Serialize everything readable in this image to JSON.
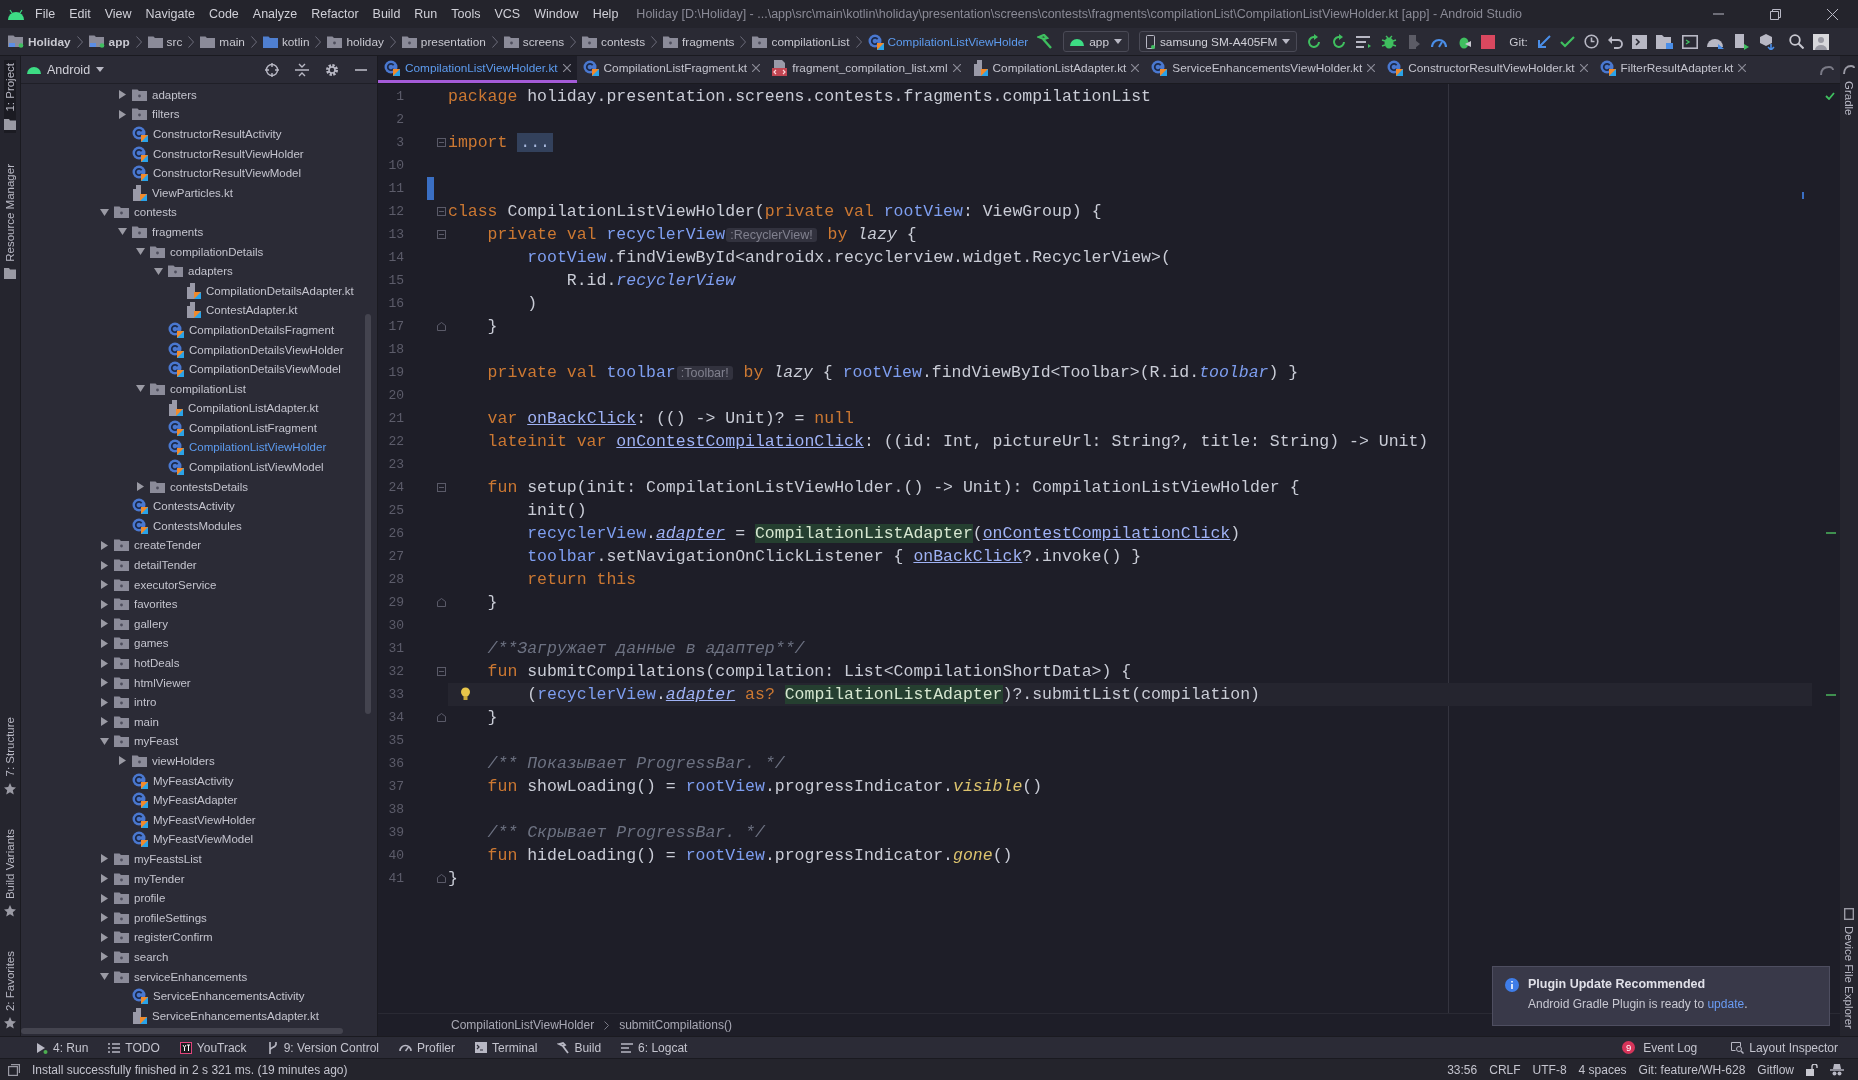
{
  "menu_bar": {
    "items": [
      "File",
      "Edit",
      "View",
      "Navigate",
      "Code",
      "Analyze",
      "Refactor",
      "Build",
      "Run",
      "Tools",
      "VCS",
      "Window",
      "Help"
    ],
    "title": "Holiday [D:\\Holiday] - ...\\app\\src\\main\\kotlin\\holiday\\presentation\\screens\\contests\\fragments\\compilationList\\CompilationListViewHolder.kt [app] - Android Studio"
  },
  "navigation_bar": {
    "breadcrumbs": [
      {
        "label": "Holiday",
        "kind": "module"
      },
      {
        "label": "app",
        "kind": "module"
      },
      {
        "label": "src",
        "kind": "folder"
      },
      {
        "label": "main",
        "kind": "folder"
      },
      {
        "label": "kotlin",
        "kind": "source_folder"
      },
      {
        "label": "holiday",
        "kind": "package"
      },
      {
        "label": "presentation",
        "kind": "package"
      },
      {
        "label": "screens",
        "kind": "package"
      },
      {
        "label": "contests",
        "kind": "package"
      },
      {
        "label": "fragments",
        "kind": "package"
      },
      {
        "label": "compilationList",
        "kind": "package"
      },
      {
        "label": "CompilationListViewHolder",
        "kind": "class"
      }
    ],
    "run_configuration": "app",
    "device": "samsung SM-A405FM",
    "git_label": "Git:"
  },
  "left_toolbar": {
    "top": [
      "1: Project",
      "Resource Manager"
    ],
    "bottom": [
      "7: Structure",
      "Build Variants",
      "2: Favorites"
    ]
  },
  "right_toolbar": {
    "top": [
      "Gradle"
    ],
    "bottom": [
      "Device File Explorer"
    ]
  },
  "project": {
    "view": "Android",
    "leading_items": [
      {
        "label": "adapters",
        "kind": "folder",
        "expanded": false,
        "selected": false
      },
      {
        "label": "filters",
        "kind": "folder",
        "expanded": false,
        "selected": false
      },
      {
        "label": "ConstructorResultActivity",
        "kind": "class",
        "selected": false
      },
      {
        "label": "ConstructorResultViewHolder",
        "kind": "class",
        "selected": false
      },
      {
        "label": "ConstructorResultViewModel",
        "kind": "class",
        "selected": false
      },
      {
        "label": "ViewParticles.kt",
        "kind": "file",
        "selected": false
      }
    ],
    "items": [
      {
        "label": "contests",
        "kind": "folder",
        "expanded": true,
        "selected": false,
        "children": [
          {
            "label": "fragments",
            "kind": "folder",
            "expanded": true,
            "selected": false,
            "children": [
              {
                "label": "compilationDetails",
                "kind": "folder",
                "expanded": true,
                "selected": false,
                "children": [
                  {
                    "label": "adapters",
                    "kind": "folder",
                    "expanded": true,
                    "selected": false,
                    "children": [
                      {
                        "label": "CompilationDetailsAdapter.kt",
                        "kind": "file",
                        "selected": false
                      },
                      {
                        "label": "ContestAdapter.kt",
                        "kind": "file",
                        "selected": false
                      }
                    ]
                  },
                  {
                    "label": "CompilationDetailsFragment",
                    "kind": "class",
                    "selected": false
                  },
                  {
                    "label": "CompilationDetailsViewHolder",
                    "kind": "class",
                    "selected": false
                  },
                  {
                    "label": "CompilationDetailsViewModel",
                    "kind": "class",
                    "selected": false
                  }
                ]
              },
              {
                "label": "compilationList",
                "kind": "folder",
                "expanded": true,
                "selected": false,
                "children": [
                  {
                    "label": "CompilationListAdapter.kt",
                    "kind": "file",
                    "selected": false
                  },
                  {
                    "label": "CompilationListFragment",
                    "kind": "class",
                    "selected": false
                  },
                  {
                    "label": "CompilationListViewHolder",
                    "kind": "class",
                    "selected": true
                  },
                  {
                    "label": "CompilationListViewModel",
                    "kind": "class",
                    "selected": false
                  }
                ]
              },
              {
                "label": "contestsDetails",
                "kind": "folder",
                "expanded": false,
                "selected": false
              }
            ]
          },
          {
            "label": "ContestsActivity",
            "kind": "class",
            "selected": false
          },
          {
            "label": "ContestsModules",
            "kind": "class",
            "selected": false
          }
        ]
      },
      {
        "label": "createTender",
        "kind": "folder",
        "expanded": false,
        "selected": false
      },
      {
        "label": "detailTender",
        "kind": "folder",
        "expanded": false,
        "selected": false
      },
      {
        "label": "executorService",
        "kind": "folder",
        "expanded": false,
        "selected": false
      },
      {
        "label": "favorites",
        "kind": "folder",
        "expanded": false,
        "selected": false
      },
      {
        "label": "gallery",
        "kind": "folder",
        "expanded": false,
        "selected": false
      },
      {
        "label": "games",
        "kind": "folder",
        "expanded": false,
        "selected": false
      },
      {
        "label": "hotDeals",
        "kind": "folder",
        "expanded": false,
        "selected": false
      },
      {
        "label": "htmlViewer",
        "kind": "folder",
        "expanded": false,
        "selected": false
      },
      {
        "label": "intro",
        "kind": "folder",
        "expanded": false,
        "selected": false
      },
      {
        "label": "main",
        "kind": "folder",
        "expanded": false,
        "selected": false
      },
      {
        "label": "myFeast",
        "kind": "folder",
        "expanded": true,
        "selected": false,
        "children": [
          {
            "label": "viewHolders",
            "kind": "folder",
            "expanded": false,
            "selected": false
          },
          {
            "label": "MyFeastActivity",
            "kind": "class",
            "selected": false
          },
          {
            "label": "MyFeastAdapter",
            "kind": "class",
            "selected": false
          },
          {
            "label": "MyFeastViewHolder",
            "kind": "class",
            "selected": false
          },
          {
            "label": "MyFeastViewModel",
            "kind": "class",
            "selected": false
          }
        ]
      },
      {
        "label": "myFeastsList",
        "kind": "folder",
        "expanded": false,
        "selected": false
      },
      {
        "label": "myTender",
        "kind": "folder",
        "expanded": false,
        "selected": false
      },
      {
        "label": "profile",
        "kind": "folder",
        "expanded": false,
        "selected": false
      },
      {
        "label": "profileSettings",
        "kind": "folder",
        "expanded": false,
        "selected": false
      },
      {
        "label": "registerConfirm",
        "kind": "folder",
        "expanded": false,
        "selected": false
      },
      {
        "label": "search",
        "kind": "folder",
        "expanded": false,
        "selected": false
      },
      {
        "label": "serviceEnhancements",
        "kind": "folder",
        "expanded": true,
        "selected": false,
        "children": [
          {
            "label": "ServiceEnhancementsActivity",
            "kind": "class",
            "selected": false
          },
          {
            "label": "ServiceEnhancementsAdapter.kt",
            "kind": "file",
            "selected": false
          }
        ]
      }
    ]
  },
  "editor_tabs": [
    {
      "label": "CompilationListViewHolder.kt",
      "kind": "class",
      "selected": true
    },
    {
      "label": "CompilationListFragment.kt",
      "kind": "class",
      "selected": false
    },
    {
      "label": "fragment_compilation_list.xml",
      "kind": "layout",
      "selected": false
    },
    {
      "label": "CompilationListAdapter.kt",
      "kind": "file",
      "selected": false
    },
    {
      "label": "ServiceEnhancementsViewHolder.kt",
      "kind": "class",
      "selected": false
    },
    {
      "label": "ConstructorResultViewHolder.kt",
      "kind": "class",
      "selected": false
    },
    {
      "label": "FilterResultAdapter.kt",
      "kind": "class",
      "selected": false
    }
  ],
  "code": {
    "lines": [
      {
        "number": "1",
        "kind": "plain",
        "current": false,
        "changed": false,
        "tokens": [
          {
            "kind": "keyword",
            "text": "package"
          },
          {
            "kind": "plain",
            "text": " holiday.presentation.screens.contests.fragments.compilationList"
          }
        ]
      },
      {
        "number": "2",
        "kind": "plain",
        "current": false,
        "changed": false
      },
      {
        "number": "3",
        "kind": "fold_start",
        "current": false,
        "changed": false,
        "tokens": [
          {
            "kind": "keyword",
            "text": "import"
          },
          {
            "kind": "folded",
            "text": "..."
          }
        ]
      },
      {
        "number": "10",
        "kind": "plain",
        "current": false,
        "changed": false
      },
      {
        "number": "11",
        "kind": "plain",
        "current": false,
        "changed": true
      },
      {
        "number": "12",
        "kind": "fold_start",
        "current": false,
        "changed": false,
        "tokens": [
          {
            "kind": "keyword",
            "text": "class"
          },
          {
            "kind": "plain",
            "text": " CompilationListViewHolder("
          },
          {
            "kind": "keyword",
            "text": "private val"
          },
          {
            "kind": "property",
            "text": " rootView"
          },
          {
            "kind": "plain",
            "text": ": ViewGroup) {"
          }
        ]
      },
      {
        "number": "13",
        "kind": "fold_start",
        "current": false,
        "changed": false,
        "tokens": [
          {
            "kind": "keyword",
            "text": "    private val"
          },
          {
            "kind": "property",
            "text": " recyclerView"
          },
          {
            "kind": "type_hint",
            "text": ":RecyclerView!"
          },
          {
            "kind": "keyword",
            "text": " by"
          },
          {
            "kind": "italic",
            "text": " lazy"
          },
          {
            "kind": "plain",
            "text": " {"
          }
        ]
      },
      {
        "number": "14",
        "kind": "plain",
        "current": false,
        "changed": false,
        "tokens": [
          {
            "kind": "property",
            "text": "        rootView"
          },
          {
            "kind": "plain",
            "text": ".findViewById<androidx.recyclerview.widget.RecyclerView>("
          }
        ]
      },
      {
        "number": "15",
        "kind": "plain",
        "current": false,
        "changed": false,
        "tokens": [
          {
            "kind": "plain",
            "text": "            R.id."
          },
          {
            "kind": "property_italic",
            "text": "recyclerView"
          }
        ]
      },
      {
        "number": "16",
        "kind": "plain",
        "current": false,
        "changed": false,
        "tokens": [
          {
            "kind": "plain",
            "text": "        )"
          }
        ]
      },
      {
        "number": "17",
        "kind": "fold_end",
        "current": false,
        "changed": false,
        "tokens": [
          {
            "kind": "plain",
            "text": "    }"
          }
        ]
      },
      {
        "number": "18",
        "kind": "plain",
        "current": false,
        "changed": false
      },
      {
        "number": "19",
        "kind": "plain",
        "current": false,
        "changed": false,
        "tokens": [
          {
            "kind": "keyword",
            "text": "    private val"
          },
          {
            "kind": "property",
            "text": " toolbar"
          },
          {
            "kind": "type_hint",
            "text": ":Toolbar!"
          },
          {
            "kind": "keyword",
            "text": " by"
          },
          {
            "kind": "italic",
            "text": " lazy"
          },
          {
            "kind": "plain",
            "text": " {"
          },
          {
            "kind": "property",
            "text": " rootView"
          },
          {
            "kind": "plain",
            "text": ".findViewById<Toolbar>(R.id."
          },
          {
            "kind": "property_italic",
            "text": "toolbar"
          },
          {
            "kind": "plain",
            "text": ") }"
          }
        ]
      },
      {
        "number": "20",
        "kind": "plain",
        "current": false,
        "changed": false
      },
      {
        "number": "21",
        "kind": "plain",
        "current": false,
        "changed": false,
        "tokens": [
          {
            "kind": "keyword",
            "text": "    var "
          },
          {
            "kind": "reference",
            "text": "onBackClick"
          },
          {
            "kind": "plain",
            "text": ": (() -> Unit)? ="
          },
          {
            "kind": "keyword",
            "text": " null"
          }
        ]
      },
      {
        "number": "22",
        "kind": "plain",
        "current": false,
        "changed": false,
        "tokens": [
          {
            "kind": "keyword",
            "text": "    lateinit var "
          },
          {
            "kind": "reference",
            "text": "onContestCompilationClick"
          },
          {
            "kind": "plain",
            "text": ": ((id: Int, pictureUrl: String?, title: String) -> Unit)"
          }
        ]
      },
      {
        "number": "23",
        "kind": "plain",
        "current": false,
        "changed": false
      },
      {
        "number": "24",
        "kind": "fold_start",
        "current": false,
        "changed": false,
        "tokens": [
          {
            "kind": "keyword",
            "text": "    fun"
          },
          {
            "kind": "plain",
            "text": " setup(init: CompilationListViewHolder.() -> Unit): CompilationListViewHolder {"
          }
        ]
      },
      {
        "number": "25",
        "kind": "plain",
        "current": false,
        "changed": false,
        "tokens": [
          {
            "kind": "plain",
            "text": "        init()"
          }
        ]
      },
      {
        "number": "26",
        "kind": "plain",
        "current": false,
        "changed": false,
        "tokens": [
          {
            "kind": "property",
            "text": "        recyclerView"
          },
          {
            "kind": "plain",
            "text": "."
          },
          {
            "kind": "reference_italic",
            "text": "adapter"
          },
          {
            "kind": "plain",
            "text": " ="
          },
          {
            "kind": "highlighted",
            "text": "CompilationListAdapter"
          },
          {
            "kind": "plain",
            "text": "("
          },
          {
            "kind": "reference",
            "text": "onContestCompilationClick"
          },
          {
            "kind": "plain",
            "text": ")"
          }
        ]
      },
      {
        "number": "27",
        "kind": "plain",
        "current": false,
        "changed": false,
        "tokens": [
          {
            "kind": "property",
            "text": "        toolbar"
          },
          {
            "kind": "plain",
            "text": ".setNavigationOnClickListener { "
          },
          {
            "kind": "reference",
            "text": "onBackClick"
          },
          {
            "kind": "plain",
            "text": "?.invoke() }"
          }
        ]
      },
      {
        "number": "28",
        "kind": "plain",
        "current": false,
        "changed": false,
        "tokens": [
          {
            "kind": "keyword",
            "text": "        return this"
          }
        ]
      },
      {
        "number": "29",
        "kind": "fold_end",
        "current": false,
        "changed": false,
        "tokens": [
          {
            "kind": "plain",
            "text": "    }"
          }
        ]
      },
      {
        "number": "30",
        "kind": "plain",
        "current": false,
        "changed": false
      },
      {
        "number": "31",
        "kind": "plain",
        "current": false,
        "changed": false,
        "tokens": [
          {
            "kind": "comment",
            "text": "    /**Загружает данные в адаптер**/"
          }
        ]
      },
      {
        "number": "32",
        "kind": "fold_start",
        "current": false,
        "changed": false,
        "tokens": [
          {
            "kind": "keyword",
            "text": "    fun"
          },
          {
            "kind": "plain",
            "text": " submitCompilations(compilation: List<CompilationShortData>) {"
          }
        ]
      },
      {
        "number": "33",
        "kind": "plain",
        "current": true,
        "changed": false,
        "tokens": [
          {
            "kind": "plain",
            "text": "        ("
          },
          {
            "kind": "property",
            "text": "recyclerView"
          },
          {
            "kind": "plain",
            "text": "."
          },
          {
            "kind": "reference_italic",
            "text": "adapter"
          },
          {
            "kind": "keyword",
            "text": " as?"
          },
          {
            "kind": "highlighted",
            "text": "CompilationListAdapter"
          },
          {
            "kind": "plain",
            "text": ")?.submitList(compilation)"
          }
        ]
      },
      {
        "number": "34",
        "kind": "fold_end",
        "current": false,
        "changed": false,
        "tokens": [
          {
            "kind": "plain",
            "text": "    }"
          }
        ]
      },
      {
        "number": "35",
        "kind": "plain",
        "current": false,
        "changed": false
      },
      {
        "number": "36",
        "kind": "plain",
        "current": false,
        "changed": false,
        "tokens": [
          {
            "kind": "comment",
            "text": "    /** Показывает ProgressBar. */"
          }
        ]
      },
      {
        "number": "37",
        "kind": "plain",
        "current": false,
        "changed": false,
        "tokens": [
          {
            "kind": "keyword",
            "text": "    fun"
          },
          {
            "kind": "plain",
            "text": " showLoading() ="
          },
          {
            "kind": "property",
            "text": " rootView"
          },
          {
            "kind": "plain",
            "text": ".progressIndicator."
          },
          {
            "kind": "call_italic",
            "text": "visible"
          },
          {
            "kind": "plain",
            "text": "()"
          }
        ]
      },
      {
        "number": "38",
        "kind": "plain",
        "current": false,
        "changed": false
      },
      {
        "number": "39",
        "kind": "plain",
        "current": false,
        "changed": false,
        "tokens": [
          {
            "kind": "comment",
            "text": "    /** Скрывает ProgressBar. */"
          }
        ]
      },
      {
        "number": "40",
        "kind": "plain",
        "current": false,
        "changed": false,
        "tokens": [
          {
            "kind": "keyword",
            "text": "    fun"
          },
          {
            "kind": "plain",
            "text": " hideLoading() ="
          },
          {
            "kind": "property",
            "text": " rootView"
          },
          {
            "kind": "plain",
            "text": ".progressIndicator."
          },
          {
            "kind": "call_italic",
            "text": "gone"
          },
          {
            "kind": "plain",
            "text": "()"
          }
        ]
      },
      {
        "number": "41",
        "kind": "fold_end",
        "current": false,
        "changed": false,
        "tokens": [
          {
            "kind": "plain",
            "text": "}"
          }
        ]
      }
    ]
  },
  "editor_breadcrumbs": [
    "CompilationListViewHolder",
    "submitCompilations()"
  ],
  "notification": {
    "title": "Plugin Update Recommended",
    "text": "Android Gradle Plugin is ready to",
    "link": "update",
    "tail": "."
  },
  "bottom_tools": {
    "left": [
      {
        "label": "4: Run",
        "kind": "run"
      },
      {
        "label": "TODO",
        "kind": "todo"
      },
      {
        "label": "YouTrack",
        "kind": "youtrack"
      },
      {
        "label": "9: Version Control",
        "kind": "vcs"
      },
      {
        "label": "Profiler",
        "kind": "profiler"
      },
      {
        "label": "Terminal",
        "kind": "terminal"
      },
      {
        "label": "Build",
        "kind": "build"
      },
      {
        "label": "6: Logcat",
        "kind": "logcat"
      }
    ],
    "right": [
      {
        "label": "Event Log",
        "kind": "event_log",
        "badge": "9"
      },
      {
        "label": "Layout Inspector",
        "kind": "inspector"
      }
    ]
  },
  "status_bar": {
    "message": "Install successfully finished in 2 s 321 ms. (19 minutes ago)",
    "items": [
      "33:56",
      "CRLF",
      "UTF-8",
      "4 spaces",
      "Git: feature/WH-628",
      "Gitflow"
    ]
  }
}
